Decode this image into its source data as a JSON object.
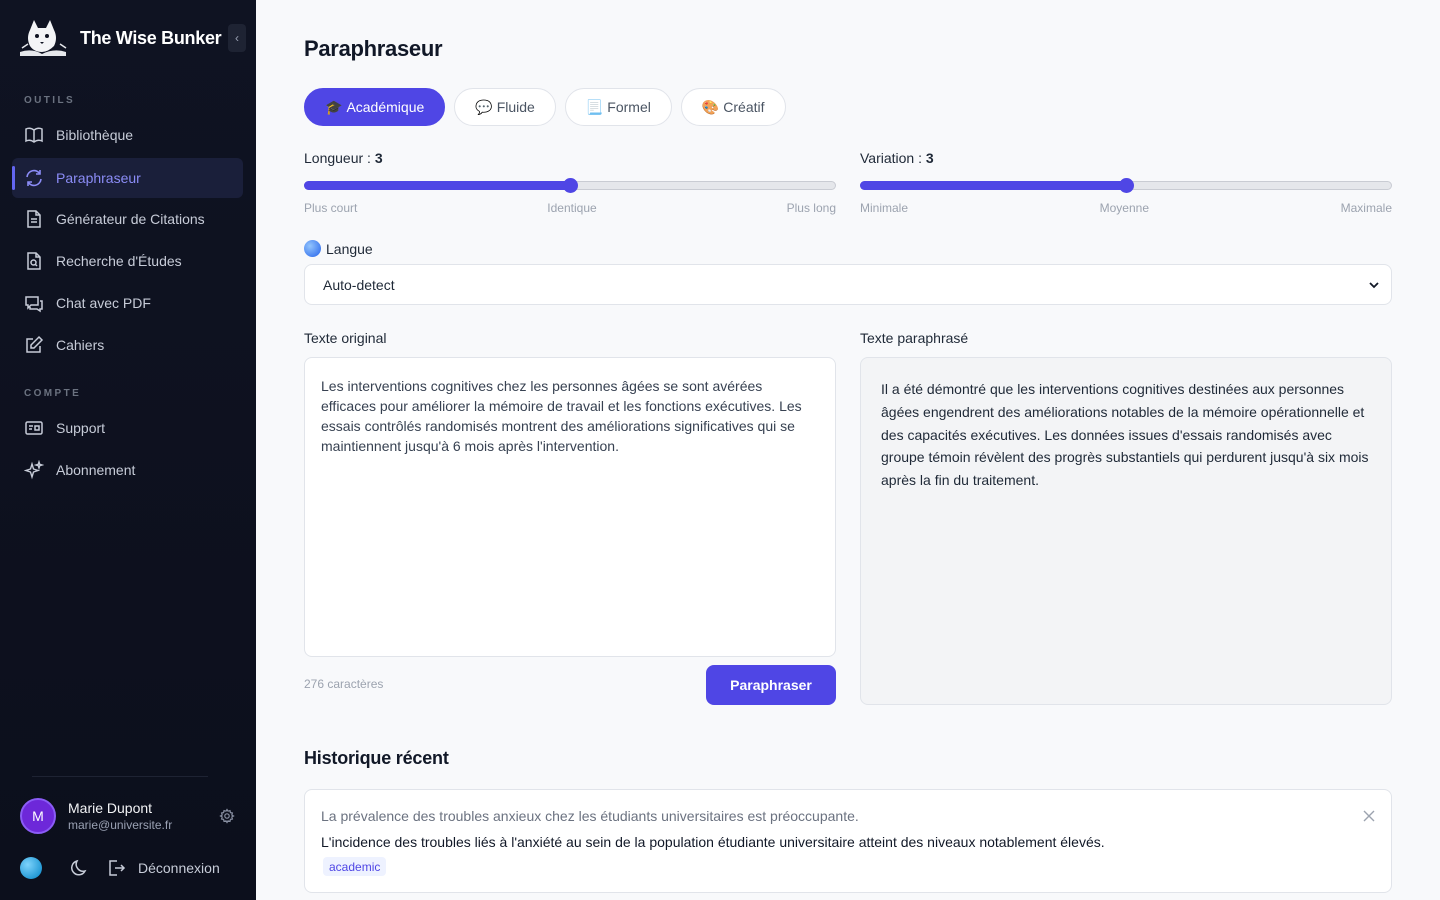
{
  "app": {
    "name": "The Wise Bunker",
    "collapse_glyph": "‹"
  },
  "sidebar": {
    "sections": [
      {
        "label": "OUTILS"
      },
      {
        "label": "COMPTE"
      }
    ],
    "tools": [
      {
        "label": "Bibliothèque",
        "icon": "book-icon"
      },
      {
        "label": "Paraphraseur",
        "icon": "refresh-icon",
        "active": true
      },
      {
        "label": "Générateur de Citations",
        "icon": "document-icon"
      },
      {
        "label": "Recherche d'Études",
        "icon": "document-search-icon"
      },
      {
        "label": "Chat avec PDF",
        "icon": "chat-icon"
      },
      {
        "label": "Cahiers",
        "icon": "edit-icon"
      }
    ],
    "account": [
      {
        "label": "Support",
        "icon": "support-ticket-icon"
      },
      {
        "label": "Abonnement",
        "icon": "sparkles-icon"
      }
    ],
    "user": {
      "initial": "M",
      "name": "Marie Dupont",
      "email": "marie@universite.fr"
    },
    "logout_label": "Déconnexion"
  },
  "page": {
    "title": "Paraphraseur",
    "modes": [
      {
        "emoji": "🎓",
        "label": "Académique",
        "active": true
      },
      {
        "emoji": "💬",
        "label": "Fluide",
        "active": false
      },
      {
        "emoji": "📃",
        "label": "Formel",
        "active": false
      },
      {
        "emoji": "🎨",
        "label": "Créatif",
        "active": false
      }
    ],
    "length": {
      "label": "Longueur :",
      "value": "3",
      "level_fraction": 0.5,
      "ticks": [
        "Plus court",
        "Identique",
        "Plus long"
      ]
    },
    "variation": {
      "label": "Variation :",
      "value": "3",
      "level_fraction": 0.5,
      "ticks": [
        "Minimale",
        "Moyenne",
        "Maximale"
      ]
    },
    "language": {
      "label": "Langue",
      "selected": "Auto-detect"
    },
    "original": {
      "label": "Texte original",
      "text": "Les interventions cognitives chez les personnes âgées se sont avérées efficaces pour améliorer la mémoire de travail et les fonctions exécutives. Les essais contrôlés randomisés montrent des améliorations significatives qui se maintiennent jusqu'à 6 mois après l'intervention.",
      "char_count": "276 caractères"
    },
    "paraphrased": {
      "label": "Texte paraphrasé",
      "text": "Il a été démontré que les interventions cognitives destinées aux personnes âgées engendrent des améliorations notables de la mémoire opérationnelle et des capacités exécutives. Les données issues d'essais randomisés avec groupe témoin révèlent des progrès substantiels qui perdurent jusqu'à six mois après la fin du traitement."
    },
    "paraphrase_button": "Paraphraser",
    "history": {
      "title": "Historique récent",
      "items": [
        {
          "original": "La prévalence des troubles anxieux chez les étudiants universitaires est préoccupante.",
          "paraphrased": "L'incidence des troubles liés à l'anxiété au sein de la population étudiante universitaire atteint des niveaux notablement élevés.",
          "tag": "academic"
        }
      ]
    }
  },
  "colors": {
    "accent": "#4f46e5",
    "sidebar_bg": "#0f1322",
    "active_nav_text": "#8b8cf6"
  }
}
